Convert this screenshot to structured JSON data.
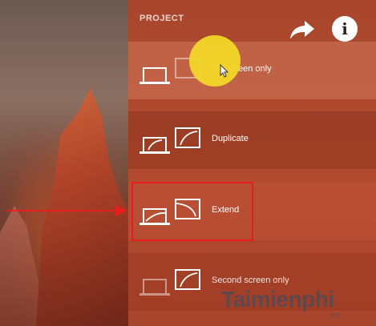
{
  "panel": {
    "title": "PROJECT",
    "options": [
      {
        "label": "PC screen only",
        "selected": false
      },
      {
        "label": "Duplicate",
        "selected": false
      },
      {
        "label": "Extend",
        "selected": true
      },
      {
        "label": "Second screen only",
        "selected": false
      }
    ]
  },
  "overlay": {
    "info_glyph": "i"
  },
  "watermark": {
    "text": "Taimienphi",
    "sub": ".vn"
  },
  "colors": {
    "panel_bg": "#b24a2f",
    "highlight_box": "#e81e1e",
    "cursor_glow": "#f2d628"
  }
}
